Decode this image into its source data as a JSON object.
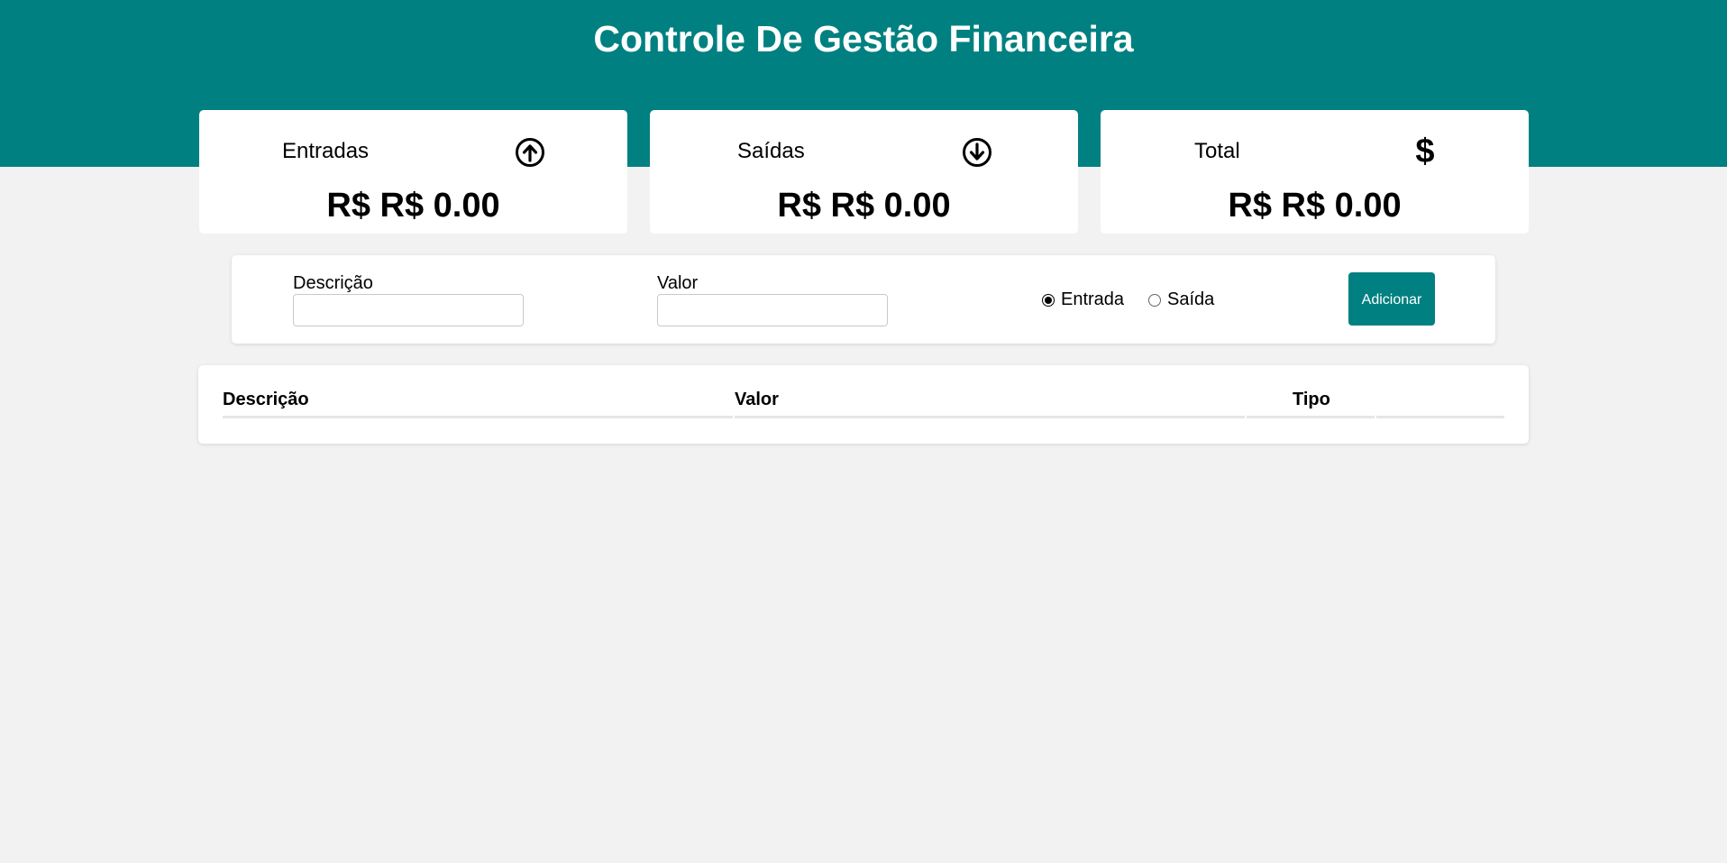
{
  "header": {
    "title": "Controle De Gestão Financeira",
    "color": "#008080"
  },
  "cards": [
    {
      "label": "Entradas",
      "icon": "arrow-up-circle-icon",
      "value": "R$ R$ 0.00"
    },
    {
      "label": "Saídas",
      "icon": "arrow-down-circle-icon",
      "value": "R$ R$ 0.00"
    },
    {
      "label": "Total",
      "icon": "dollar-icon",
      "value": "R$ R$ 0.00"
    }
  ],
  "form": {
    "description_label": "Descrição",
    "description_value": "",
    "value_label": "Valor",
    "value_value": "",
    "radio_options": [
      {
        "label": "Entrada",
        "checked": true
      },
      {
        "label": "Saída",
        "checked": false
      }
    ],
    "add_button": "Adicionar"
  },
  "table": {
    "columns": [
      "Descrição",
      "Valor",
      "Tipo",
      ""
    ],
    "rows": []
  }
}
